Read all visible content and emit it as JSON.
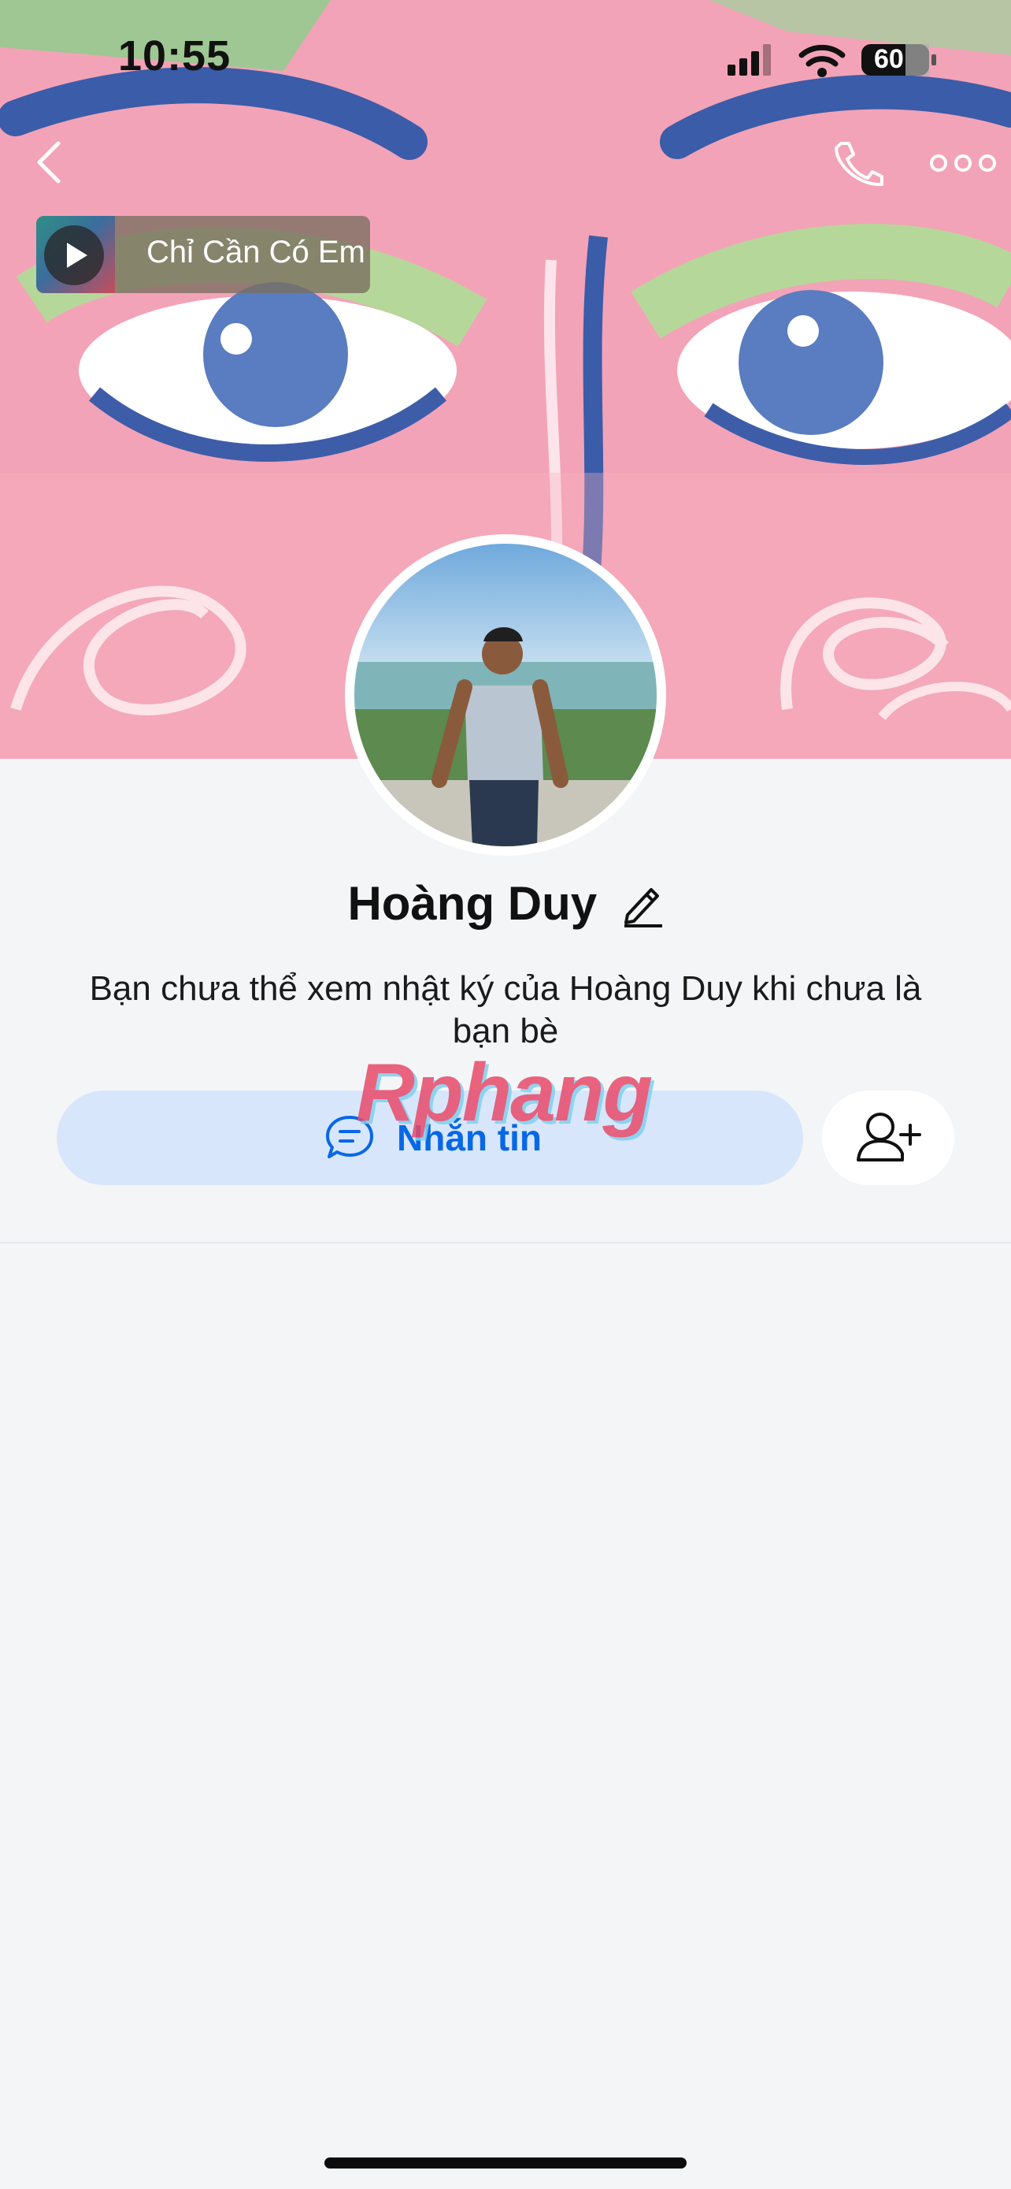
{
  "status_bar": {
    "time": "10:55",
    "battery": "60"
  },
  "music": {
    "title": "Chỉ Cần Có Em"
  },
  "profile": {
    "name": "Hoàng Duy",
    "privacy_note": "Bạn chưa thể xem nhật ký của Hoàng Duy khi chưa là bạn bè"
  },
  "actions": {
    "message_label": "Nhắn tin"
  },
  "watermark": "Rphang",
  "icons": {
    "back": "chevron-left-icon",
    "call": "phone-icon",
    "more": "more-horizontal-icon",
    "edit": "pencil-icon",
    "chat": "chat-bubble-icon",
    "add_friend": "add-user-icon",
    "play": "play-icon"
  },
  "colors": {
    "accent": "#0867e6",
    "message_button_bg": "#d8e6fb",
    "page_bg": "#f4f5f7"
  }
}
